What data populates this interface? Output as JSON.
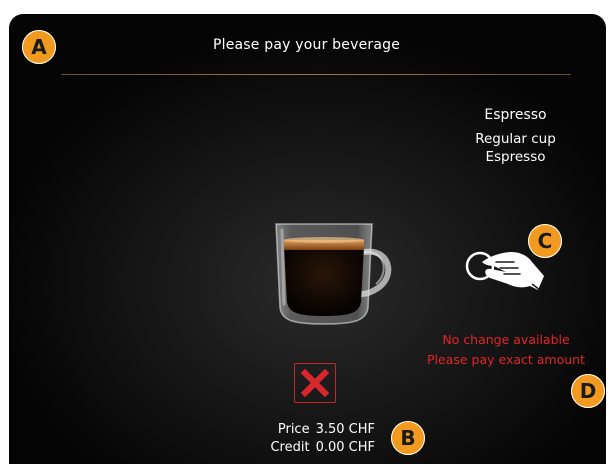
{
  "screen": {
    "title": "Please pay your beverage"
  },
  "beverage": {
    "name": "Espresso",
    "cup_size": "Regular cup",
    "type": "Espresso"
  },
  "payment": {
    "warning_line_1": "No change available",
    "warning_line_2": "Please pay exact amount",
    "price_label": "Price",
    "price_value": "3.50 CHF",
    "credit_label": "Credit",
    "credit_value": "0.00 CHF"
  },
  "icons": {
    "cup": "espresso-cup-icon",
    "coin": "coin-insert-icon",
    "cancel": "close-icon"
  },
  "markers": {
    "a": "A",
    "b": "B",
    "c": "C",
    "d": "D"
  },
  "colors": {
    "background": "#0b0b0b",
    "text": "#ffffff",
    "warning": "#e0252a",
    "cancel": "#d8262b",
    "marker": "#f29a1f",
    "divider": "#9a7650"
  }
}
